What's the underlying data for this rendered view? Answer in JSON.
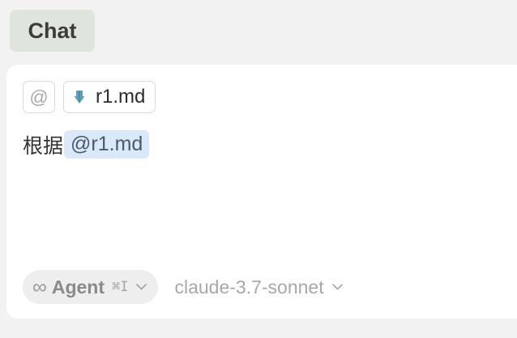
{
  "header": {
    "tab_label": "Chat"
  },
  "composer": {
    "context": {
      "at_symbol": "@",
      "file_icon": "arrow-down-icon",
      "file_name": "r1.md"
    },
    "message": {
      "text": "根据",
      "mention": "@r1.md"
    },
    "footer": {
      "mode_icon": "infinity-icon",
      "mode_glyph": "∞",
      "mode_label": "Agent",
      "mode_shortcut": "⌘I",
      "model_name": "claude-3.7-sonnet"
    }
  },
  "colors": {
    "tab_bg": "#dfe4dc",
    "mention_bg": "#dae8fb",
    "file_icon": "#5aa0b8"
  }
}
